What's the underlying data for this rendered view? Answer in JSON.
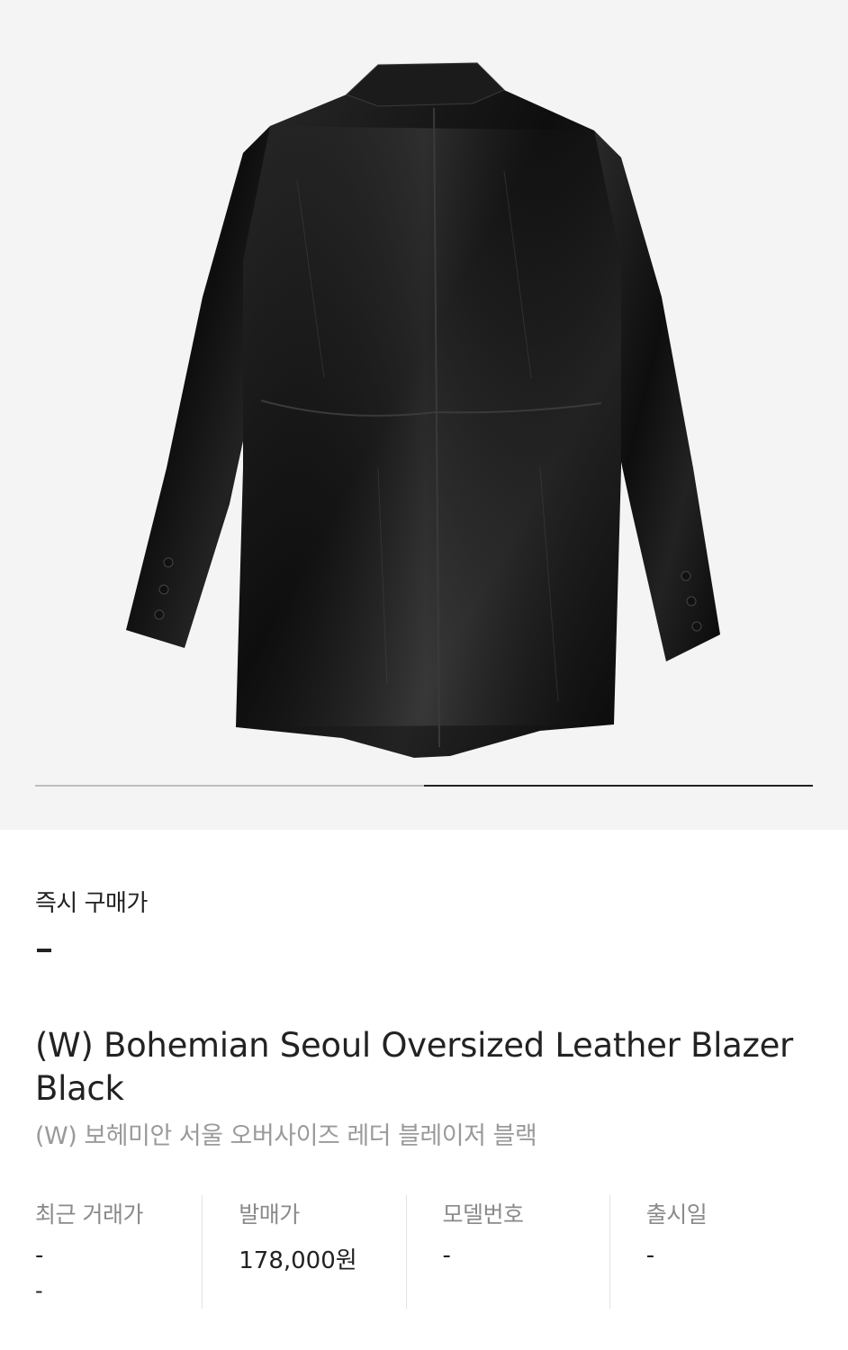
{
  "gallery": {
    "image_alt": "black leather blazer back view",
    "page_count": 2,
    "current_page": 2
  },
  "instant_buy": {
    "label": "즉시 구매가",
    "value": "-"
  },
  "product": {
    "title_en": "(W) Bohemian Seoul Oversized Leather Blazer Black",
    "title_ko": "(W) 보헤미안 서울 오버사이즈 레더 블레이저 블랙"
  },
  "info": [
    {
      "label": "최근 거래가",
      "value": "-",
      "sub": "-"
    },
    {
      "label": "발매가",
      "value": "178,000원"
    },
    {
      "label": "모델번호",
      "value": "-"
    },
    {
      "label": "출시일",
      "value": "-"
    }
  ]
}
